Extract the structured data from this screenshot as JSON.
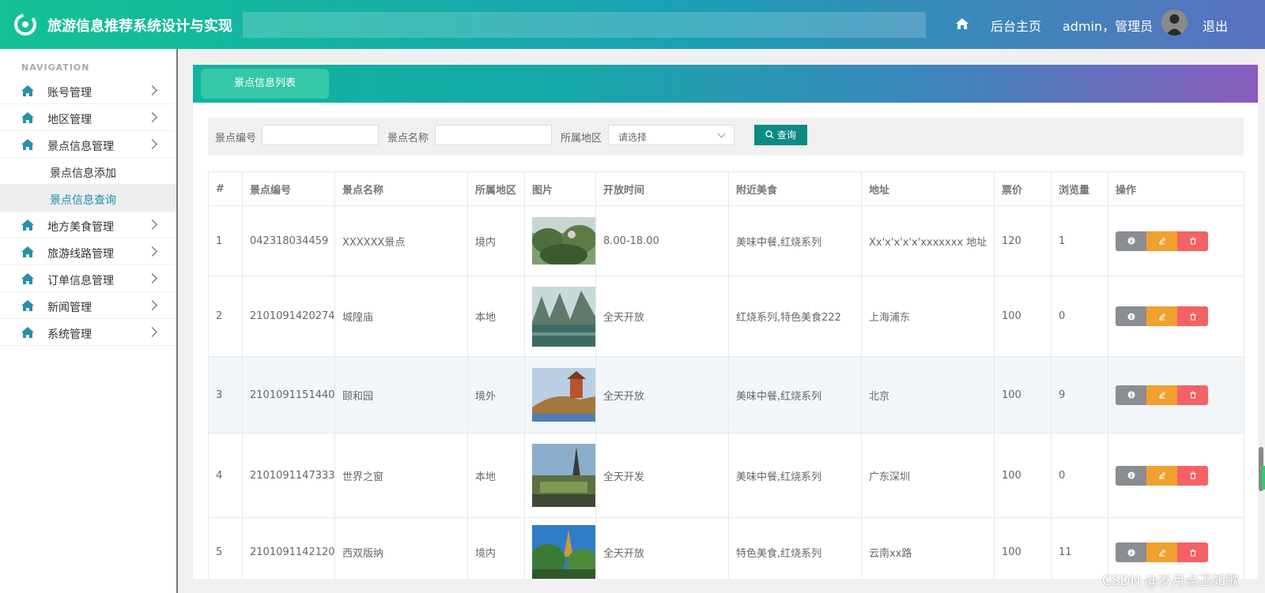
{
  "header": {
    "app_title": "旅游信息推荐系统设计与实现",
    "search_placeholder": "",
    "home_label": "后台主页",
    "user_label": "admin，管理员",
    "logout_label": "退出"
  },
  "sidebar": {
    "caption": "NAVIGATION",
    "items": [
      {
        "label": "账号管理"
      },
      {
        "label": "地区管理"
      },
      {
        "label": "景点信息管理"
      },
      {
        "label": "景点信息添加"
      },
      {
        "label": "景点信息查询"
      },
      {
        "label": "地方美食管理"
      },
      {
        "label": "旅游线路管理"
      },
      {
        "label": "订单信息管理"
      },
      {
        "label": "新闻管理"
      },
      {
        "label": "系统管理"
      }
    ]
  },
  "panel": {
    "tab_label": "景点信息列表"
  },
  "filters": {
    "code_label": "景点编号",
    "code_value": "",
    "name_label": "景点名称",
    "name_value": "",
    "region_label": "所属地区",
    "region_selected": "请选择",
    "search_button": "查询"
  },
  "table": {
    "columns": [
      "#",
      "景点编号",
      "景点名称",
      "所属地区",
      "图片",
      "开放时间",
      "附近美食",
      "地址",
      "票价",
      "浏览量",
      "操作"
    ],
    "rows": [
      {
        "idx": "1",
        "code": "042318034459",
        "name": "XXXXXX景点",
        "region": "境内",
        "open": "8.00-18.00",
        "food": "美味中餐,红烧系列",
        "address": "Xx'x'x'x'x'xxxxxxx 地址",
        "price": "120",
        "views": "1"
      },
      {
        "idx": "2",
        "code": "2101091420274",
        "name": "城隍庙",
        "region": "本地",
        "open": "全天开放",
        "food": "红烧系列,特色美食222",
        "address": "上海浦东",
        "price": "100",
        "views": "0"
      },
      {
        "idx": "3",
        "code": "2101091151440",
        "name": "颐和园",
        "region": "境外",
        "open": "全天开放",
        "food": "美味中餐,红烧系列",
        "address": "北京",
        "price": "100",
        "views": "9"
      },
      {
        "idx": "4",
        "code": "2101091147333",
        "name": "世界之窗",
        "region": "本地",
        "open": "全天开发",
        "food": "美味中餐,红烧系列",
        "address": "广东深圳",
        "price": "100",
        "views": "0"
      },
      {
        "idx": "5",
        "code": "2101091142120",
        "name": "西双版纳",
        "region": "境内",
        "open": "全天开放",
        "food": "特色美食,红烧系列",
        "address": "云南xx路",
        "price": "100",
        "views": "11"
      }
    ]
  },
  "watermark": "CSDN @岁月忐忑如歌",
  "colors": {
    "header_start": "#13c194",
    "header_end": "#5a71bf",
    "search_button": "#0e8a85",
    "active_nav": "#1a8fa8",
    "btn_info": "#8a8d92",
    "btn_edit": "#f0a02e",
    "btn_delete": "#f46266"
  }
}
